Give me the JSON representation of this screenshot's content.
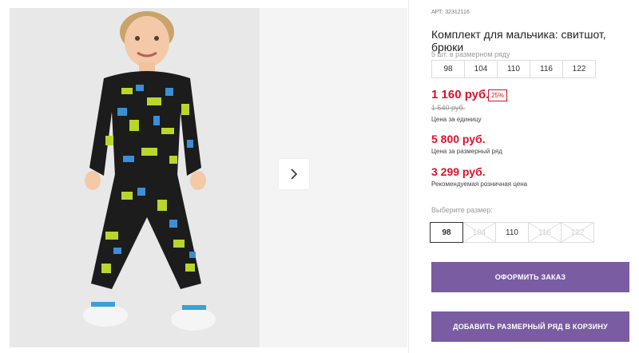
{
  "product": {
    "article_label": "АРТ:",
    "article_value": "32312116",
    "title": "Комплект для мальчика: свитшот, брюки"
  },
  "set_sizes": {
    "label": "5 шт. в размерном ряду",
    "items": [
      "98",
      "104",
      "110",
      "116",
      "122"
    ]
  },
  "prices": {
    "unit_price": "1 160 руб.",
    "discount": "25%",
    "old_price": "1 540 руб.",
    "unit_label": "Цена за единицу",
    "set_price": "5 800 руб.",
    "set_label": "Цена за размерный ряд",
    "rrp_price": "3 299 руб.",
    "rrp_label": "Рекомендуемая розничная цена"
  },
  "size_selector": {
    "label": "Выберите размер:",
    "sizes": [
      {
        "value": "98",
        "state": "selected"
      },
      {
        "value": "104",
        "state": "disabled"
      },
      {
        "value": "110",
        "state": "available"
      },
      {
        "value": "116",
        "state": "disabled"
      },
      {
        "value": "122",
        "state": "disabled"
      }
    ]
  },
  "actions": {
    "order_label": "ОФОРМИТЬ ЗАКАЗ",
    "add_set_label": "ДОБАВИТЬ РАЗМЕРНЫЙ РЯД В КОРЗИНУ"
  },
  "gallery": {
    "next_icon": "chevron-right-icon"
  },
  "colors": {
    "accent_price": "#e0102a",
    "button": "#7a5ca3"
  }
}
